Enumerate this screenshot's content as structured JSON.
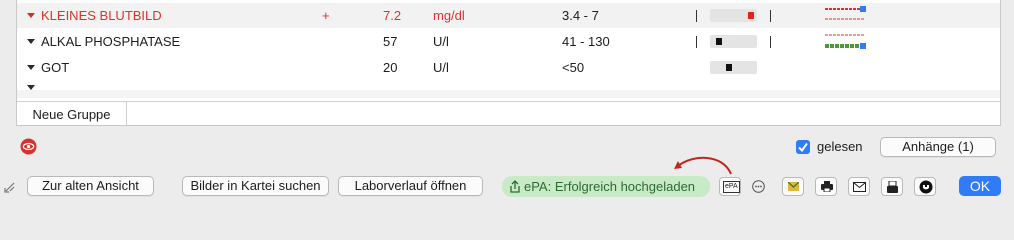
{
  "rows": [
    {
      "name": "KLEINES BLUTBILD",
      "flag": "+",
      "value": "7.2",
      "unit": "mg/dl",
      "range": "3.4 - 7",
      "level": 0.95
    },
    {
      "name": "ALKAL PHOSPHATASE",
      "flag": "",
      "value": "57",
      "unit": "U/l",
      "range": "41 - 130",
      "level": 0.15
    },
    {
      "name": "GOT",
      "flag": "",
      "value": "20",
      "unit": "U/l",
      "range": "<50",
      "level": 0.4
    }
  ],
  "group_tab": "Neue Gruppe",
  "read_label": "gelesen",
  "attachments_button": "Anhänge (1)",
  "old_view_button": "Zur alten Ansicht",
  "search_images_button": "Bilder in Kartei suchen",
  "lab_history_button": "Laborverlauf öffnen",
  "epa_status": "ePA: Erfolgreich hochgeladen",
  "epa_icon_label": "ePA",
  "ok_button": "OK",
  "colors": {
    "alert": "#e0322b",
    "accent": "#2f7cf6",
    "epa_bg": "#c8eac6"
  }
}
